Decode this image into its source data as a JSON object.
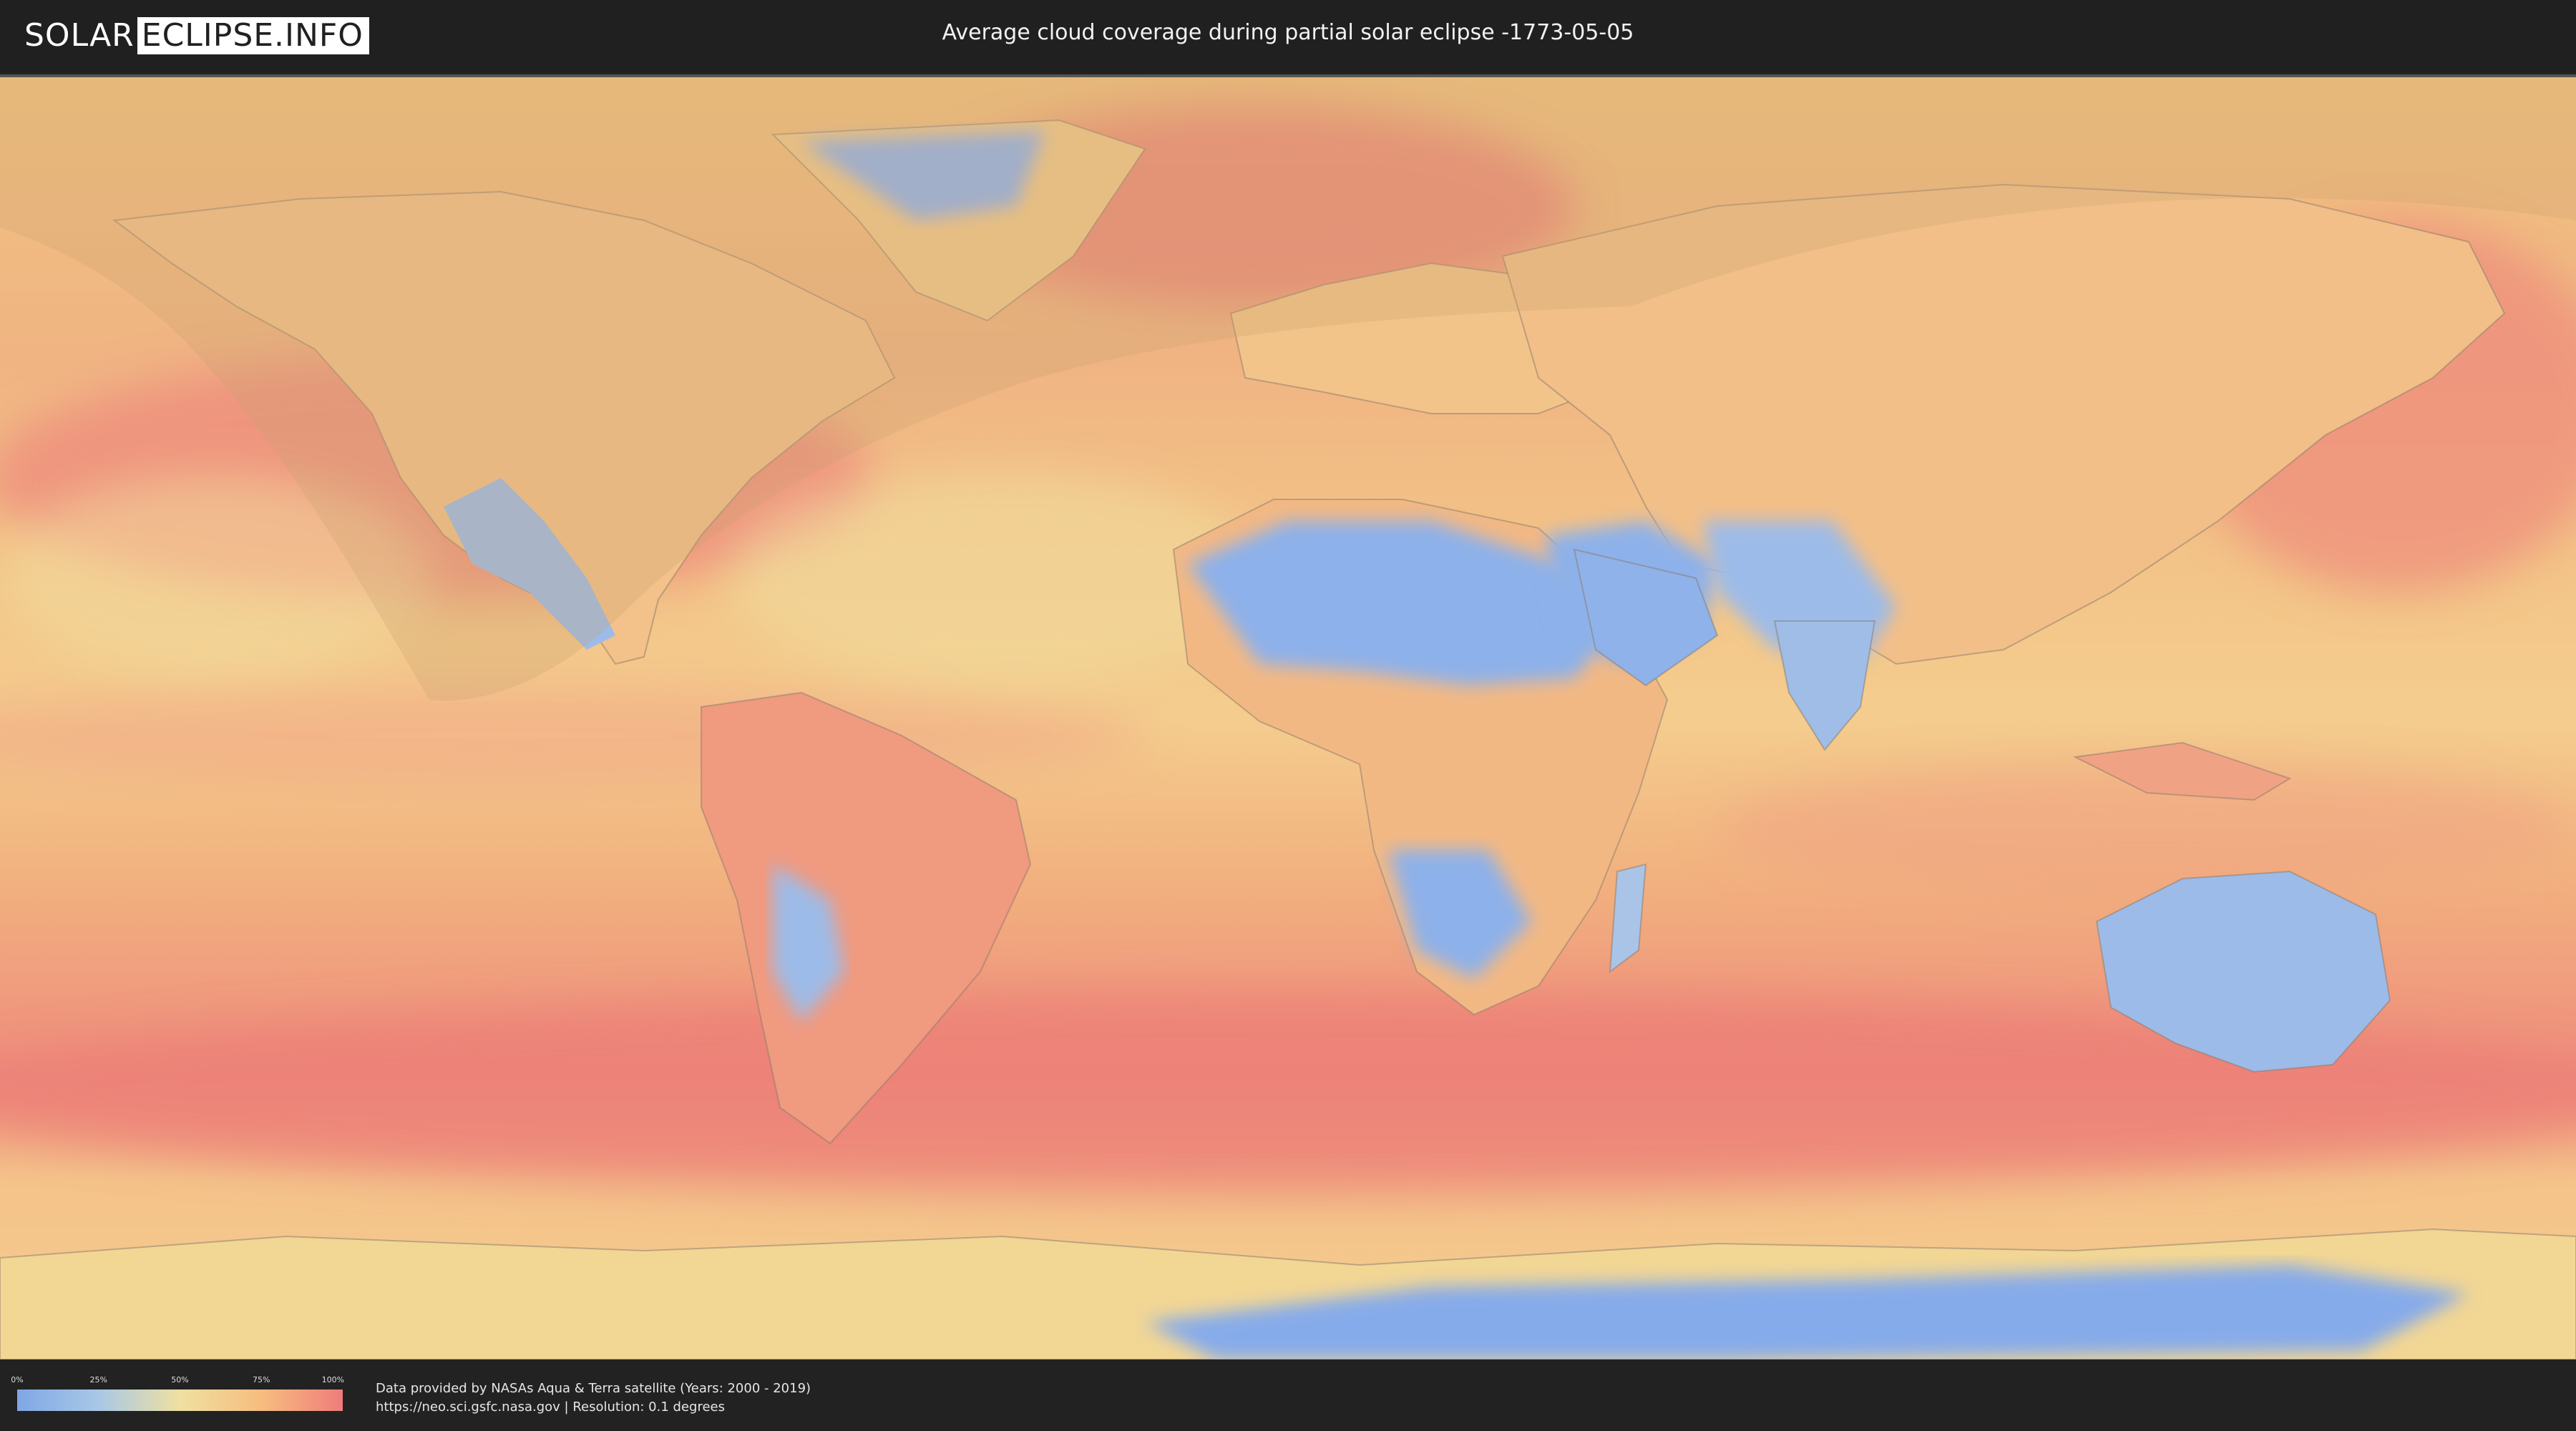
{
  "header": {
    "logo_left": "SOLAR",
    "logo_right": "ECLIPSE.INFO",
    "title": "Average cloud coverage during partial solar eclipse -1773-05-05"
  },
  "legend": {
    "ticks": [
      {
        "label": "0%",
        "value": 0
      },
      {
        "label": "25%",
        "value": 25
      },
      {
        "label": "50%",
        "value": 50
      },
      {
        "label": "75%",
        "value": 75
      },
      {
        "label": "100%",
        "value": 100
      }
    ],
    "colors": [
      "#7fa7e6",
      "#a8c8e6",
      "#efe0a0",
      "#f6bd7f",
      "#f07c7c"
    ]
  },
  "credits": {
    "line1": "Data provided by NASAs Aqua & Terra satellite (Years: 2000 - 2019)",
    "line2": "https://neo.sci.gsfc.nasa.gov | Resolution: 0.1 degrees"
  },
  "map": {
    "projection": "equirectangular",
    "colors": {
      "ocean_cloudy": "#ef8a7c",
      "moderate": "#f4bf86",
      "low": "#efe1a2",
      "clear": "#8db1ea",
      "eclipse_shade": "#c8a070"
    }
  }
}
